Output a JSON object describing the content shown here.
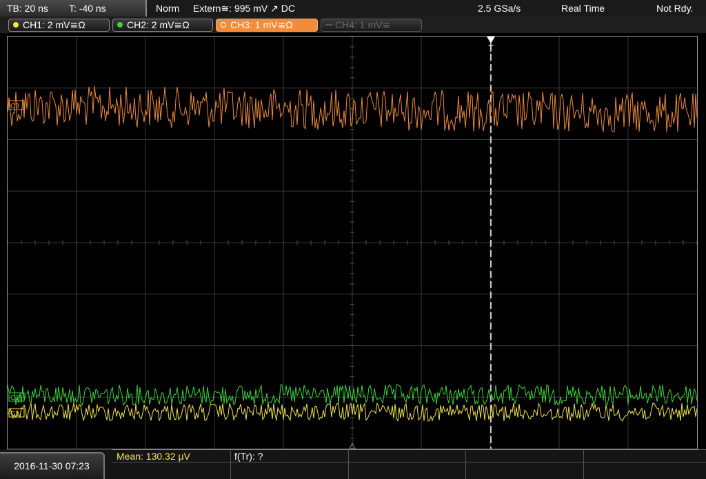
{
  "topbar": {
    "timebase": "TB: 20 ns",
    "trigger_pos": "T: -40 ns",
    "mode": "Norm",
    "trigger_source": "Extern≅: 995 mV ↗ DC",
    "sample_rate": "2.5 GSa/s",
    "acq_mode": "Real Time",
    "status": "Not Rdy."
  },
  "channels": [
    {
      "label": "CH1: 2 mV≅Ω",
      "color": "#f4e64a"
    },
    {
      "label": "CH2: 2 mV≅Ω",
      "color": "#3ad63a"
    },
    {
      "label": "CH3: 1 mV≅Ω",
      "color": "#f08c3c"
    },
    {
      "label": "CH4: 1 mV≅",
      "color": "#6a6a6a"
    }
  ],
  "markers": {
    "trigger": "T",
    "ch3": "C3",
    "ch2": "C2",
    "ch1": "C1"
  },
  "bottombar": {
    "datetime": "2016-11-30 07:23",
    "mean": "Mean: 130.32 µV",
    "ftr": "f(Tr): ?"
  },
  "colors": {
    "ch1": "#f4e64a",
    "ch2": "#3ad63a",
    "ch3": "#f08c3c",
    "grid": "#3a3a3a",
    "mean_text": "#f4e64a"
  }
}
